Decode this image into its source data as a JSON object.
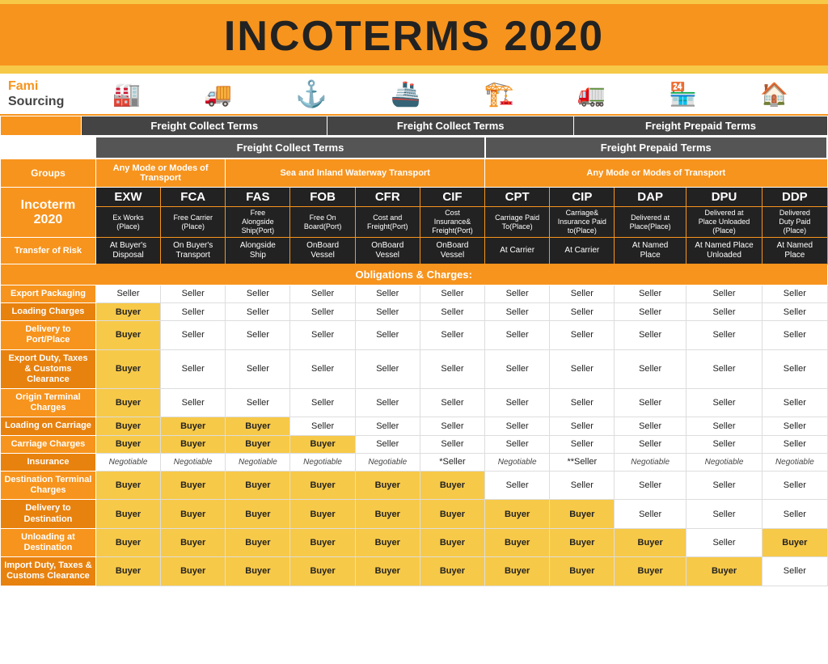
{
  "title": "INCOTERMS 2020",
  "logo": {
    "line1": "Fami",
    "line2": "Sourcing"
  },
  "icons": [
    "🏭",
    "🚚",
    "⚓",
    "🚢",
    "🏗️",
    "🚛",
    "🏪",
    "🏠"
  ],
  "freight_collect_label": "Freight Collect Terms",
  "freight_prepaid_label": "Freight Prepaid Terms",
  "groups_label": "Groups",
  "any_mode_left": "Any Mode or Modes of Transport",
  "sea_inland": "Sea and Inland Waterway Transport",
  "any_mode_right": "Any Mode or Modes of Transport",
  "incoterm_label": "Incoterm\n2020",
  "transfer_risk_label": "Transfer of Risk",
  "obligations_label": "Obligations & Charges:",
  "terms": [
    {
      "code": "EXW",
      "desc": "Ex Works\n(Place)",
      "risk": "At Buyer's\nDisposal"
    },
    {
      "code": "FCA",
      "desc": "Free Carrier\n(Place)",
      "risk": "On Buyer's\nTransport"
    },
    {
      "code": "FAS",
      "desc": "Free\nAlongside\nShip(Port)",
      "risk": "Alongside\nShip"
    },
    {
      "code": "FOB",
      "desc": "Free On\nBoard(Port)",
      "risk": "OnBoard\nVessel"
    },
    {
      "code": "CFR",
      "desc": "Cost and\nFreight(Port)",
      "risk": "OnBoard\nVessel"
    },
    {
      "code": "CIF",
      "desc": "Cost\nInsurance&\nFreight(Port)",
      "risk": "OnBoard\nVessel"
    },
    {
      "code": "CPT",
      "desc": "Carriage Paid\nTo(Place)",
      "risk": "At Carrier"
    },
    {
      "code": "CIP",
      "desc": "Carriage&\nInsurance Paid\nto(Place)",
      "risk": "At Carrier"
    },
    {
      "code": "DAP",
      "desc": "Delivered at\nPlace(Place",
      "risk": "At Named\nPlace"
    },
    {
      "code": "DPU",
      "desc": "Delivered at\nPlace Unloaded\n(Place)",
      "risk": "At Named Place\nUnloaded"
    },
    {
      "code": "DDP",
      "desc": "Delivered\nDuty Paid\n(Place)",
      "risk": "At Named\nPlace"
    }
  ],
  "rows": [
    {
      "label": "Export Packaging",
      "values": [
        "Seller",
        "Seller",
        "Seller",
        "Seller",
        "Seller",
        "Seller",
        "Seller",
        "Seller",
        "Seller",
        "Seller",
        "Seller"
      ]
    },
    {
      "label": "Loading Charges",
      "values": [
        "Buyer",
        "Seller",
        "Seller",
        "Seller",
        "Seller",
        "Seller",
        "Seller",
        "Seller",
        "Seller",
        "Seller",
        "Seller"
      ]
    },
    {
      "label": "Delivery to Port/Place",
      "values": [
        "Buyer",
        "Seller",
        "Seller",
        "Seller",
        "Seller",
        "Seller",
        "Seller",
        "Seller",
        "Seller",
        "Seller",
        "Seller"
      ]
    },
    {
      "label": "Export Duty, Taxes & Customs Clearance",
      "values": [
        "Buyer",
        "Seller",
        "Seller",
        "Seller",
        "Seller",
        "Seller",
        "Seller",
        "Seller",
        "Seller",
        "Seller",
        "Seller"
      ]
    },
    {
      "label": "Origin Terminal Charges",
      "values": [
        "Buyer",
        "Seller",
        "Seller",
        "Seller",
        "Seller",
        "Seller",
        "Seller",
        "Seller",
        "Seller",
        "Seller",
        "Seller"
      ]
    },
    {
      "label": "Loading on Carriage",
      "values": [
        "Buyer",
        "Buyer",
        "Buyer",
        "Seller",
        "Seller",
        "Seller",
        "Seller",
        "Seller",
        "Seller",
        "Seller",
        "Seller"
      ]
    },
    {
      "label": "Carriage Charges",
      "values": [
        "Buyer",
        "Buyer",
        "Buyer",
        "Buyer",
        "Seller",
        "Seller",
        "Seller",
        "Seller",
        "Seller",
        "Seller",
        "Seller"
      ]
    },
    {
      "label": "Insurance",
      "values": [
        "Negotiable",
        "Negotiable",
        "Negotiable",
        "Negotiable",
        "Negotiable",
        "*Seller",
        "Negotiable",
        "**Seller",
        "Negotiable",
        "Negotiable",
        "Negotiable"
      ]
    },
    {
      "label": "Destination Terminal Charges",
      "values": [
        "Buyer",
        "Buyer",
        "Buyer",
        "Buyer",
        "Buyer",
        "Buyer",
        "Seller",
        "Seller",
        "Seller",
        "Seller",
        "Seller"
      ]
    },
    {
      "label": "Delivery to Destination",
      "values": [
        "Buyer",
        "Buyer",
        "Buyer",
        "Buyer",
        "Buyer",
        "Buyer",
        "Buyer",
        "Buyer",
        "Seller",
        "Seller",
        "Seller"
      ]
    },
    {
      "label": "Unloading at Destination",
      "values": [
        "Buyer",
        "Buyer",
        "Buyer",
        "Buyer",
        "Buyer",
        "Buyer",
        "Buyer",
        "Buyer",
        "Buyer",
        "Seller",
        "Buyer"
      ]
    },
    {
      "label": "Import Duty, Taxes & Customs Clearance",
      "values": [
        "Buyer",
        "Buyer",
        "Buyer",
        "Buyer",
        "Buyer",
        "Buyer",
        "Buyer",
        "Buyer",
        "Buyer",
        "Buyer",
        "Seller"
      ]
    }
  ]
}
